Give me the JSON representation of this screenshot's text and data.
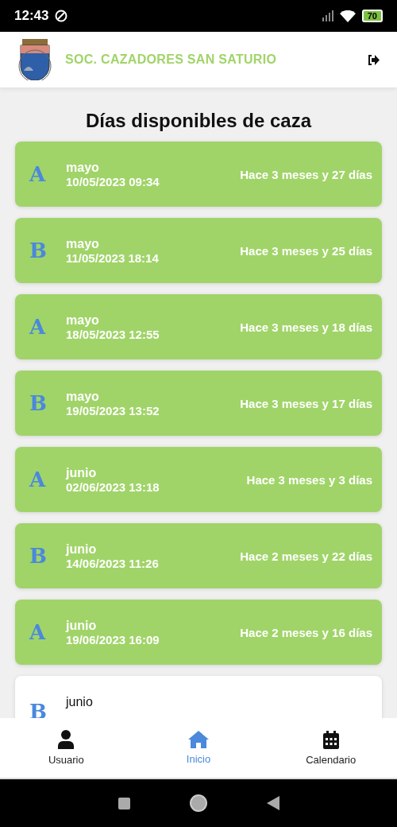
{
  "status_bar": {
    "time": "12:43",
    "battery": "70"
  },
  "header": {
    "title": "SOC. CAZADORES SAN SATURIO"
  },
  "page_title": "Días disponibles de caza",
  "days": [
    {
      "group": "A",
      "month": "mayo",
      "date": "10/05/2023 09:34",
      "ago": "Hace 3 meses y 27 días",
      "available": true
    },
    {
      "group": "B",
      "month": "mayo",
      "date": "11/05/2023 18:14",
      "ago": "Hace 3 meses y 25 días",
      "available": true
    },
    {
      "group": "A",
      "month": "mayo",
      "date": "18/05/2023 12:55",
      "ago": "Hace 3 meses y 18 días",
      "available": true
    },
    {
      "group": "B",
      "month": "mayo",
      "date": "19/05/2023 13:52",
      "ago": "Hace 3 meses y 17 días",
      "available": true
    },
    {
      "group": "A",
      "month": "junio",
      "date": "02/06/2023 13:18",
      "ago": "Hace 3 meses y 3 días",
      "available": true
    },
    {
      "group": "B",
      "month": "junio",
      "date": "14/06/2023 11:26",
      "ago": "Hace 2 meses y 22 días",
      "available": true
    },
    {
      "group": "A",
      "month": "junio",
      "date": "19/06/2023 16:09",
      "ago": "Hace 2 meses y 16 días",
      "available": true
    },
    {
      "group": "B",
      "month": "junio",
      "available": false
    }
  ],
  "bottom_nav": [
    {
      "kind": "user",
      "label": "Usuario",
      "selected": false
    },
    {
      "kind": "home",
      "label": "Inicio",
      "selected": true
    },
    {
      "kind": "calendar",
      "label": "Calendario",
      "selected": false
    }
  ]
}
